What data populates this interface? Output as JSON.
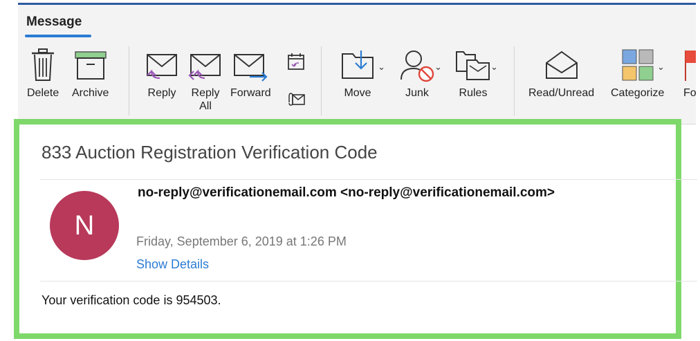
{
  "ribbon": {
    "tab_label": "Message",
    "buttons": {
      "delete": "Delete",
      "archive": "Archive",
      "reply": "Reply",
      "reply_all_line1": "Reply",
      "reply_all_line2": "All",
      "forward": "Forward",
      "move": "Move",
      "junk": "Junk",
      "rules": "Rules",
      "read_unread": "Read/Unread",
      "categorize": "Categorize",
      "partial": "Fo"
    },
    "icons": [
      "trash-icon",
      "archive-box-icon",
      "reply-icon",
      "reply-all-icon",
      "forward-icon",
      "meeting-icon",
      "attachment-icon",
      "move-folder-icon",
      "junk-icon",
      "rules-icon",
      "open-envelope-icon",
      "category-grid-icon",
      "flag-icon"
    ],
    "colors": {
      "accent": "#2b7cd3",
      "reply_arrow": "#9b59b6",
      "forward_arrow": "#2b7cd3"
    }
  },
  "message": {
    "subject": "833 Auction Registration Verification Code",
    "avatar_letter": "N",
    "avatar_color": "#b8395a",
    "sender": "no-reply@verificationemail.com <no-reply@verificationemail.com>",
    "date": "Friday, September 6, 2019 at 1:26 PM",
    "show_details": "Show Details",
    "body": "Your verification code is 954503."
  },
  "highlight_color": "#7ed86a"
}
